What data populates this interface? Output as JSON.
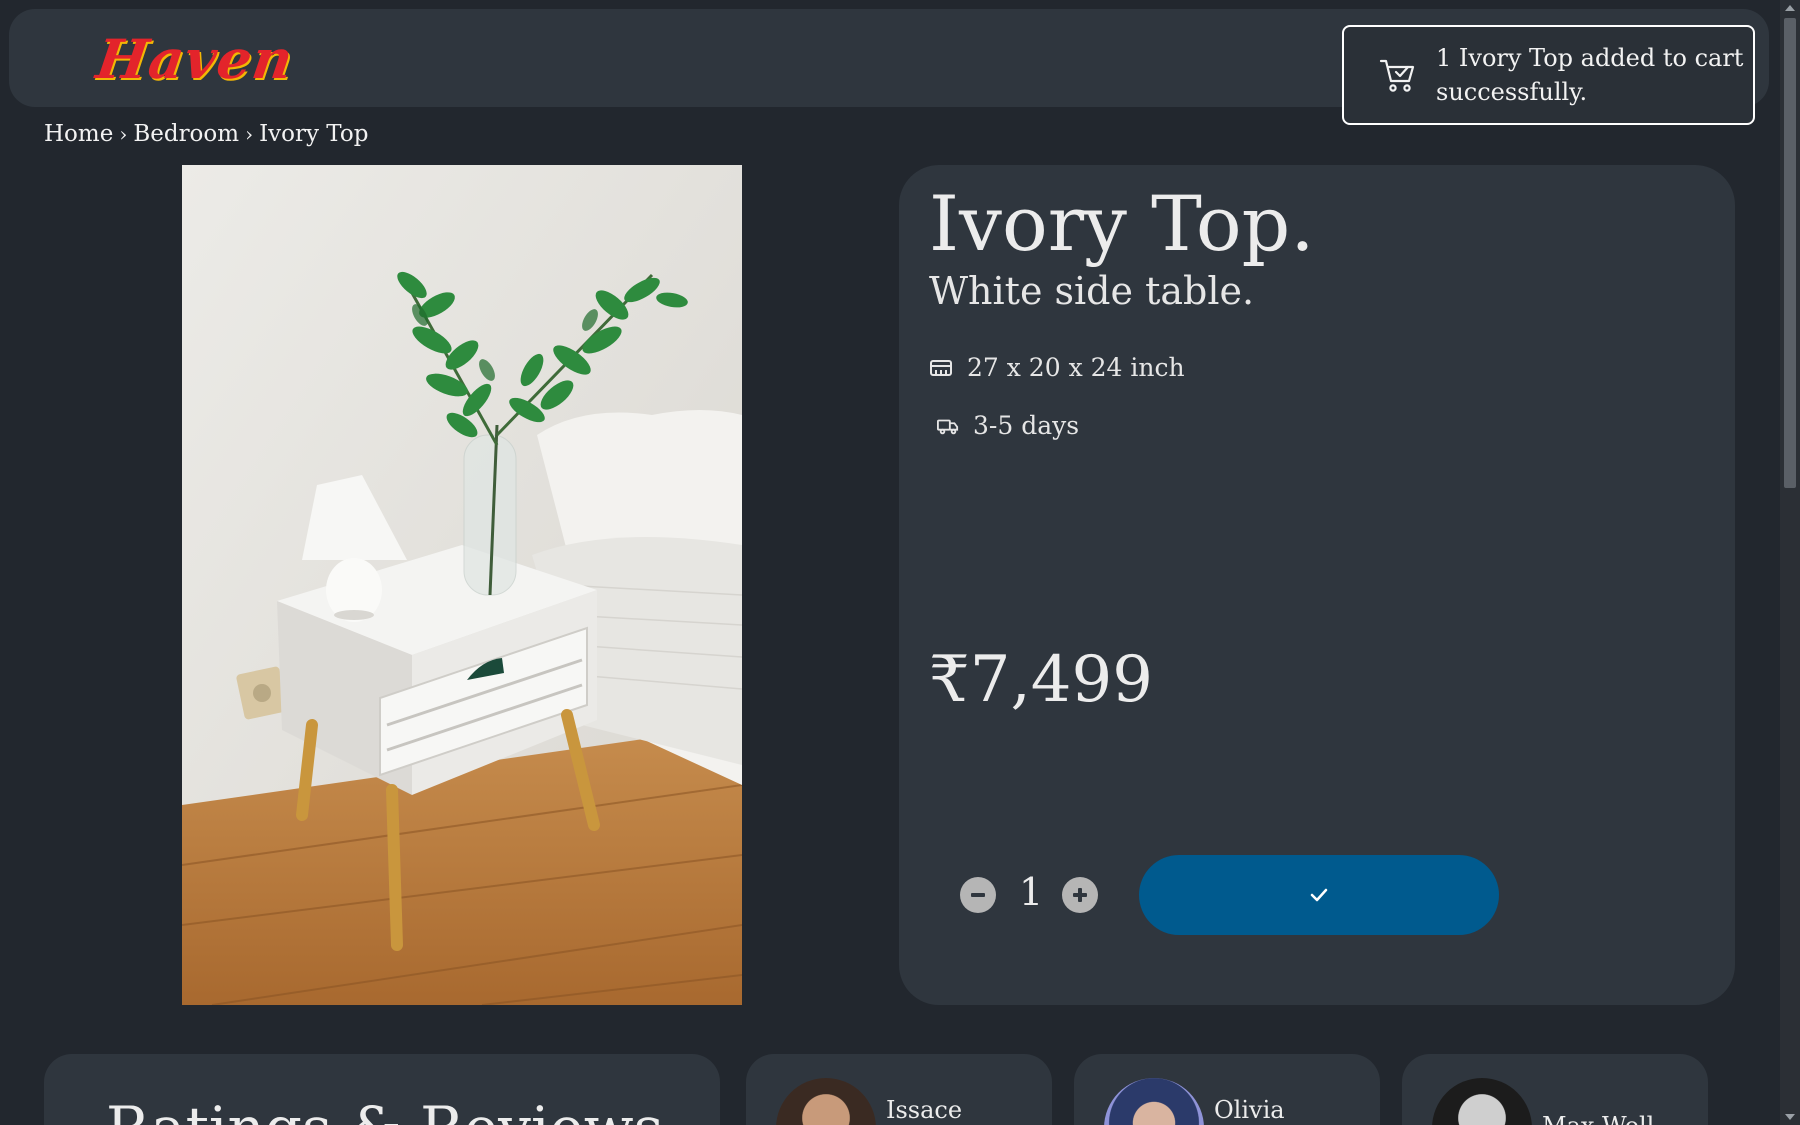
{
  "brand": {
    "logo_text": "Haven"
  },
  "toast": {
    "message": "1 Ivory Top added to cart successfully.",
    "icon": "cart-check-icon"
  },
  "breadcrumb": [
    "Home",
    "Bedroom",
    "Ivory Top"
  ],
  "product": {
    "image_icon": "product-photo",
    "title": "Ivory Top.",
    "subtitle": "White side table.",
    "dimensions": "27 x 20 x 24 inch",
    "delivery": "3-5 days",
    "price": "₹7,499",
    "quantity": "1"
  },
  "reviews": {
    "heading": "Ratings & Reviews",
    "reviewers": [
      "Issace",
      "Olivia",
      "Max Well"
    ]
  },
  "colors": {
    "background": "#22272e",
    "panel": "#2f363e",
    "accent_button": "#005a8e",
    "logo": "#e3242b"
  }
}
